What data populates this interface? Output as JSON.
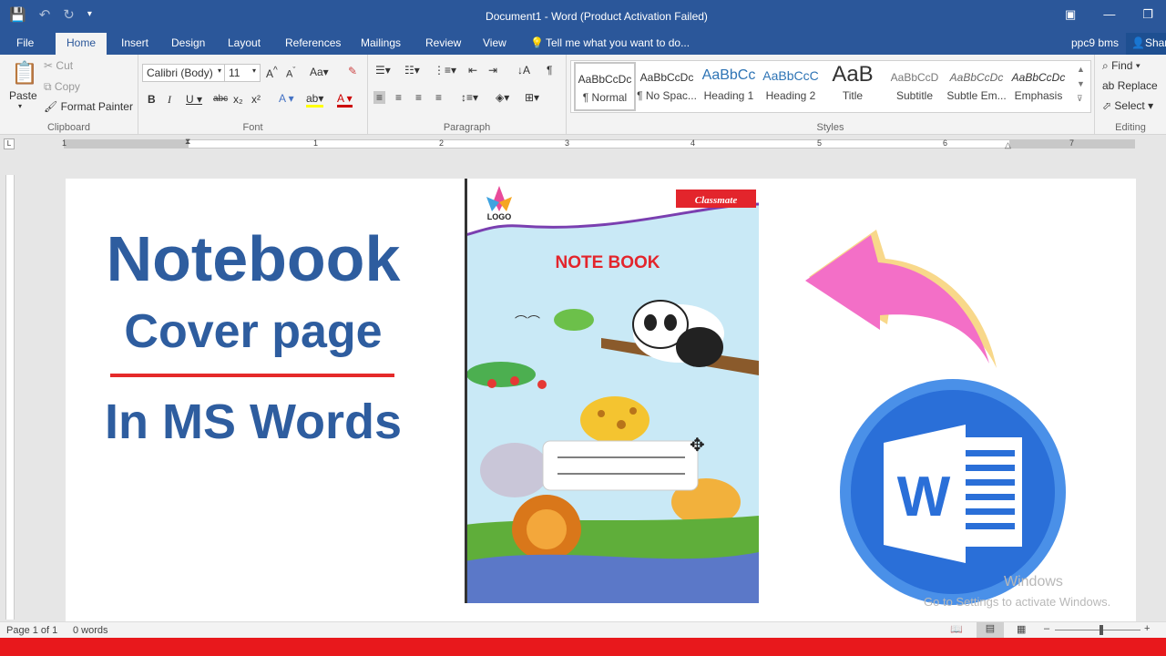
{
  "titlebar": {
    "title": "Document1 - Word (Product Activation Failed)"
  },
  "tabs": [
    "File",
    "Home",
    "Insert",
    "Design",
    "Layout",
    "References",
    "Mailings",
    "Review",
    "View"
  ],
  "tell_me": "Tell me what you want to do...",
  "user": "ppc9 bms",
  "share": "Share",
  "clipboard": {
    "paste": "Paste",
    "cut": "Cut",
    "copy": "Copy",
    "format_painter": "Format Painter",
    "label": "Clipboard"
  },
  "font": {
    "name": "Calibri (Body)",
    "size": "11",
    "label": "Font"
  },
  "paragraph": {
    "label": "Paragraph"
  },
  "styles": {
    "label": "Styles",
    "items": [
      {
        "preview": "AaBbCcDc",
        "name": "¶ Normal"
      },
      {
        "preview": "AaBbCcDc",
        "name": "¶ No Spac..."
      },
      {
        "preview": "AaBbCc",
        "name": "Heading 1"
      },
      {
        "preview": "AaBbCcC",
        "name": "Heading 2"
      },
      {
        "preview": "AaB",
        "name": "Title"
      },
      {
        "preview": "AaBbCcD",
        "name": "Subtitle"
      },
      {
        "preview": "AaBbCcDc",
        "name": "Subtle Em..."
      },
      {
        "preview": "AaBbCcDc",
        "name": "Emphasis"
      }
    ]
  },
  "editing": {
    "find": "Find",
    "replace": "Replace",
    "select": "Select",
    "label": "Editing"
  },
  "ruler_numbers": [
    "1",
    "1",
    "2",
    "3",
    "4",
    "5",
    "6",
    "7"
  ],
  "document": {
    "headline1": "Notebook",
    "headline2": "Cover page",
    "headline3": "In MS Words",
    "cover_title": "NOTE BOOK",
    "cover_logo": "LOGO",
    "cover_brand": "Classmate",
    "word_logo_letter": "W"
  },
  "watermark": {
    "line1": "Windows",
    "line2": "Go to Settings to activate Windows."
  },
  "status": {
    "page": "Page 1 of 1",
    "words": "0 words"
  },
  "colors": {
    "brand": "#2b579a",
    "headline": "#2e5d9f",
    "divider": "#e52a2a",
    "arrow_pink": "#f36fc7",
    "arrow_yellow": "#f8d88a",
    "word_blue": "#2a6fd8",
    "red_bar": "#e8181c"
  }
}
